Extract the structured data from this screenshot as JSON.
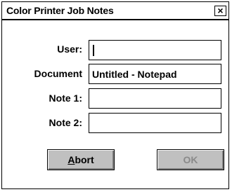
{
  "window": {
    "title": "Color Printer Job Notes",
    "close_glyph": "×"
  },
  "fields": {
    "user": {
      "label": "User:",
      "value": ""
    },
    "document": {
      "label": "Document",
      "value": "Untitled - Notepad"
    },
    "note1": {
      "label": "Note 1:",
      "value": ""
    },
    "note2": {
      "label": "Note 2:",
      "value": ""
    }
  },
  "buttons": {
    "abort": {
      "mnemonic": "A",
      "rest": "bort",
      "enabled": true
    },
    "ok": {
      "label": "OK",
      "enabled": false
    }
  }
}
